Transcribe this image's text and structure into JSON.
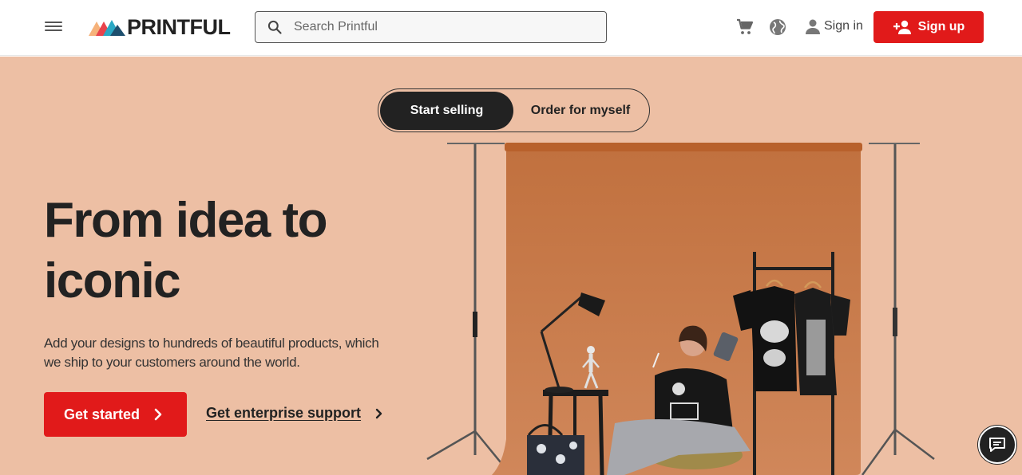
{
  "header": {
    "logo_text": "PRINTFUL",
    "search_placeholder": "Search Printful",
    "sign_in_label": "Sign in",
    "sign_up_label": "Sign up"
  },
  "hero": {
    "toggle": {
      "options": [
        "Start selling",
        "Order for myself"
      ],
      "active": "Start selling"
    },
    "headline_line1": "From idea to",
    "headline_line2": "iconic",
    "subtext": "Add your designs to hundreds of beautiful products, which we ship to your customers around the world.",
    "cta_label": "Get started",
    "enterprise_label": "Get enterprise support"
  },
  "colors": {
    "brand_red": "#e11a1a",
    "hero_bg": "#edbfa4",
    "backdrop": "#c97a4a",
    "dark": "#222222"
  },
  "icons": [
    "menu-icon",
    "printful-logo-icon",
    "search-icon",
    "cart-icon",
    "globe-icon",
    "person-icon",
    "add-person-icon",
    "chevron-right-icon",
    "chat-icon"
  ]
}
